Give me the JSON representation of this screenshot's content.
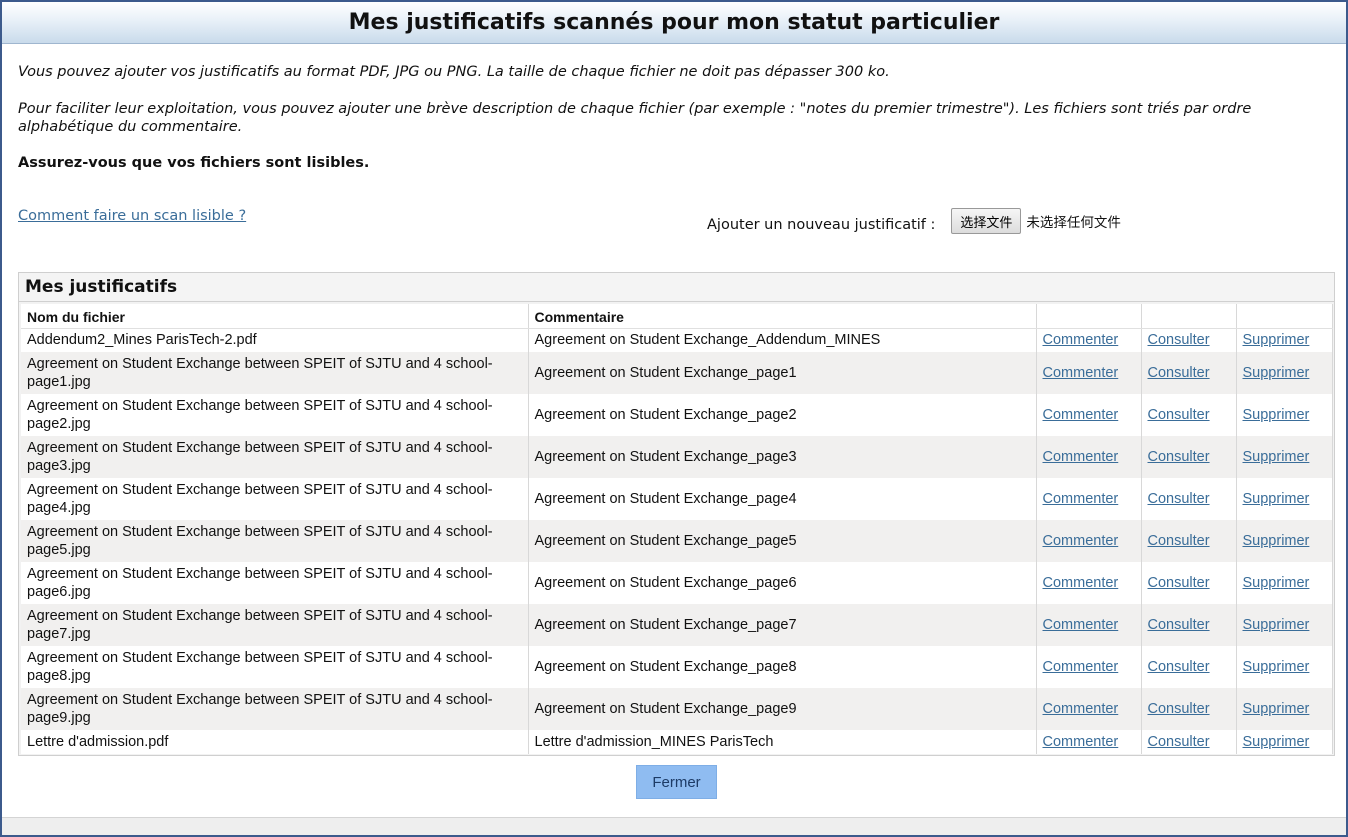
{
  "title": "Mes justificatifs scannés pour mon statut particulier",
  "intro": {
    "line1": "Vous pouvez ajouter vos justificatifs au format PDF, JPG ou PNG. La taille de chaque fichier ne doit pas dépasser 300 ko.",
    "line2": "Pour faciliter leur exploitation, vous pouvez ajouter une brève description de chaque fichier (par exemple : \"notes du premier trimestre\"). Les fichiers sont triés par ordre alphabétique du commentaire.",
    "line3": "Assurez-vous que vos fichiers sont lisibles."
  },
  "scan_link": "Comment faire un scan lisible ?",
  "upload": {
    "label": "Ajouter un nouveau justificatif :",
    "button": "选择文件",
    "status": "未选择任何文件"
  },
  "panel_title": "Mes justificatifs",
  "table": {
    "headers": [
      "Nom du fichier",
      "Commentaire",
      "",
      "",
      ""
    ],
    "actions": [
      "Commenter",
      "Consulter",
      "Supprimer"
    ],
    "rows": [
      {
        "file": "Addendum2_Mines ParisTech-2.pdf",
        "comment": "Agreement on Student Exchange_Addendum_MINES"
      },
      {
        "file": "Agreement on Student Exchange between SPEIT of SJTU and 4 school-page1.jpg",
        "comment": "Agreement on Student Exchange_page1"
      },
      {
        "file": "Agreement on Student Exchange between SPEIT of SJTU and 4 school-page2.jpg",
        "comment": "Agreement on Student Exchange_page2"
      },
      {
        "file": "Agreement on Student Exchange between SPEIT of SJTU and 4 school-page3.jpg",
        "comment": "Agreement on Student Exchange_page3"
      },
      {
        "file": "Agreement on Student Exchange between SPEIT of SJTU and 4 school-page4.jpg",
        "comment": "Agreement on Student Exchange_page4"
      },
      {
        "file": "Agreement on Student Exchange between SPEIT of SJTU and 4 school-page5.jpg",
        "comment": "Agreement on Student Exchange_page5"
      },
      {
        "file": "Agreement on Student Exchange between SPEIT of SJTU and 4 school-page6.jpg",
        "comment": "Agreement on Student Exchange_page6"
      },
      {
        "file": "Agreement on Student Exchange between SPEIT of SJTU and 4 school-page7.jpg",
        "comment": "Agreement on Student Exchange_page7"
      },
      {
        "file": "Agreement on Student Exchange between SPEIT of SJTU and 4 school-page8.jpg",
        "comment": "Agreement on Student Exchange_page8"
      },
      {
        "file": "Agreement on Student Exchange between SPEIT of SJTU and 4 school-page9.jpg",
        "comment": "Agreement on Student Exchange_page9"
      },
      {
        "file": "Lettre d'admission.pdf",
        "comment": "Lettre d'admission_MINES ParisTech"
      }
    ]
  },
  "close_button": "Fermer",
  "colors": {
    "link": "#3a6d99",
    "title_gradient_bottom": "#c9dbeb",
    "close_button_bg": "#8fbcf1",
    "border": "#3c5a8c"
  }
}
